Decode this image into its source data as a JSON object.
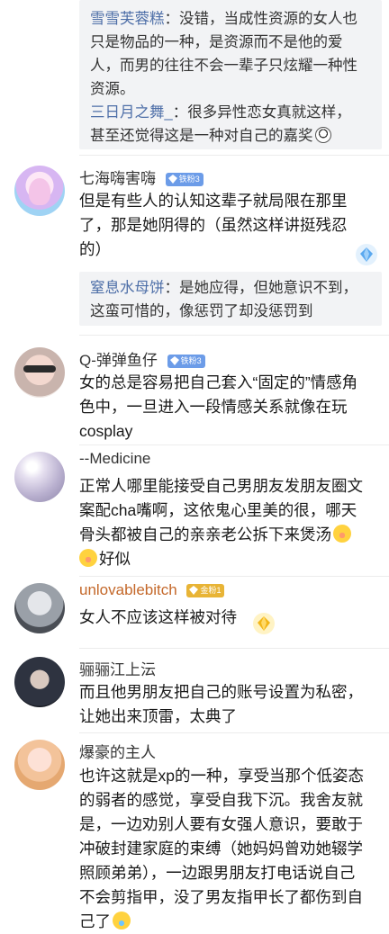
{
  "top_replies": [
    {
      "name": "雪雪芙蓉糕",
      "lines": [
        "只是物品的一种，是资源而不是他的爱",
        "人，而男的往往不会一辈子只炫耀一种性",
        "资源。"
      ],
      "first": "：没错，当成性资源的女人也"
    },
    {
      "name": "三日月之舞_",
      "first": "：很多异性恋女真就这样，",
      "lines": [
        "甚至还觉得这是一种对自己的嘉奖"
      ]
    }
  ],
  "comments": [
    {
      "name": "七海嗨害嗨",
      "badge": "铁粉3",
      "badge_color": "#6c9ce8",
      "lines": [
        "但是有些人的认知这辈子就局限在那里",
        "了，那是她阴得的（虽然这样讲挺残忍",
        "的）"
      ],
      "reply": {
        "name": "窒息水母饼",
        "first": "：是她应得，但她意识不到，",
        "lines": [
          "这蛮可惜的，像惩罚了却没惩罚到"
        ]
      }
    },
    {
      "name": "Q-弹弹鱼仔",
      "badge": "铁粉3",
      "badge_color": "#6c9ce8",
      "lines": [
        "女的总是容易把自己套入“固定的”情感角",
        "色中，一旦进入一段情感关系就像在玩",
        "cosplay"
      ]
    },
    {
      "name": "--Medicine",
      "badge": "",
      "lines": [
        "正常人哪里能接受自己男朋友发朋友圈文",
        "案配cha嘴啊，这依鬼心里美的很，哪天",
        "骨头都被自己的亲亲老公拆下来煲汤"
      ],
      "tail": "好似"
    },
    {
      "name": "unlovablebitch",
      "badge": "金粉1",
      "badge_color": "#e8b436",
      "lines": [
        "女人不应该这样被对待"
      ]
    },
    {
      "name": "骊骊江上沄",
      "badge": "",
      "lines": [
        "而且他男朋友把自己的账号设置为私密，",
        "让她出来顶雷，太典了"
      ]
    },
    {
      "name": "爆豪的主人",
      "badge": "",
      "lines": [
        "也许这就是xp的一种，享受当那个低姿态",
        "的弱者的感觉，享受自我下沉。我舍友就",
        "是，一边劝别人要有女强人意识，要敢于",
        "冲破封建家庭的束缚（她妈妈曾劝她辍学",
        "照顾弟弟），一边跟男朋友打电话说自己",
        "不会剪指甲，没了男友指甲长了都伤到自",
        "己了"
      ]
    }
  ],
  "icons": {
    "reward": "diamond-reward-icon",
    "emoji_laugh": "laughing-emoji-icon",
    "emoji_shy": "shy-emoji-icon"
  },
  "colors": {
    "link": "#4e6fa8",
    "reply_bg": "#f2f3f5"
  }
}
